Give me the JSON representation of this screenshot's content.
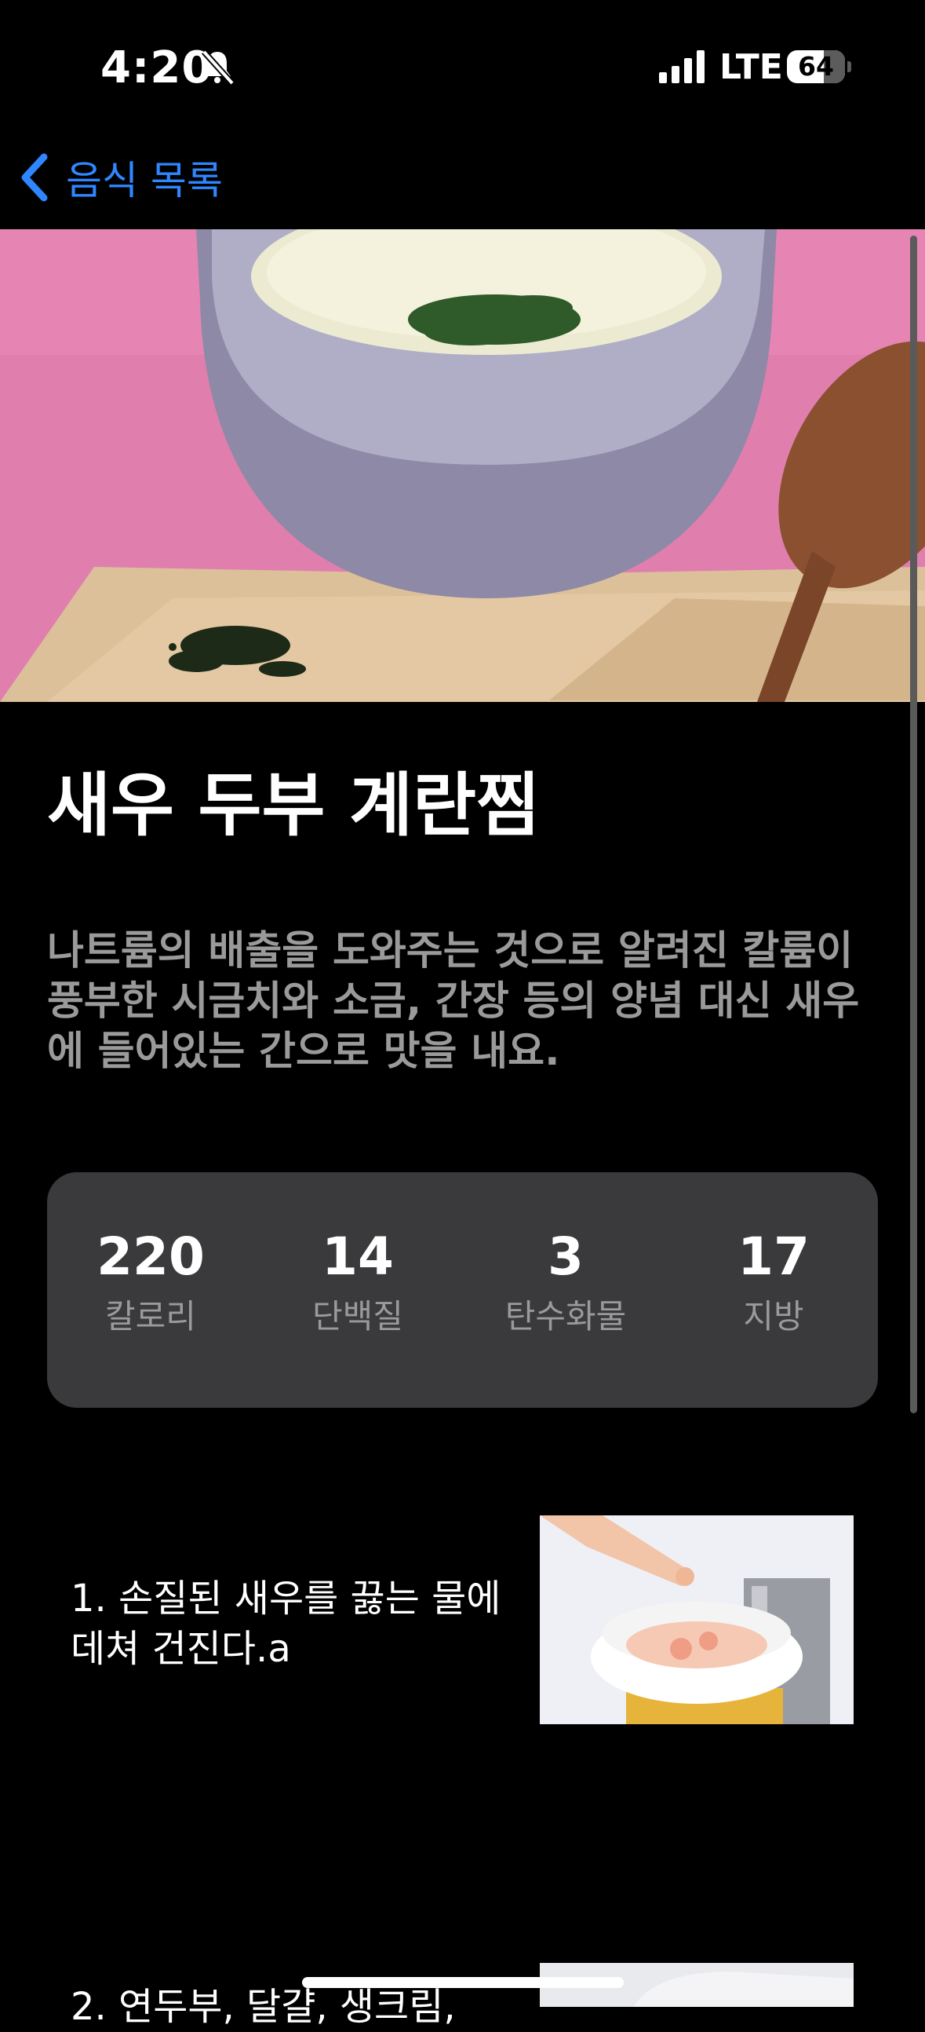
{
  "status": {
    "time": "4:20",
    "network": "LTE",
    "battery": "64",
    "battery_level_percent": 64
  },
  "nav": {
    "back_label": "음식 목록"
  },
  "recipe": {
    "title": "새우 두부 계란찜",
    "description": "나트륨의 배출을 도와주는 것으로 알려진 칼륨이 풍부한 시금치와 소금, 간장 등의 양념 대신 새우에 들어있는 간으로 맛을 내요."
  },
  "nutrition": [
    {
      "value": "220",
      "label": "칼로리"
    },
    {
      "value": "14",
      "label": "단백질"
    },
    {
      "value": "3",
      "label": "탄수화물"
    },
    {
      "value": "17",
      "label": "지방"
    }
  ],
  "steps": [
    {
      "text": "1. 손질된 새우를 끓는 물에 데쳐 건진다.a"
    },
    {
      "text": "2. 연두부, 달걀, 생크림,"
    }
  ]
}
